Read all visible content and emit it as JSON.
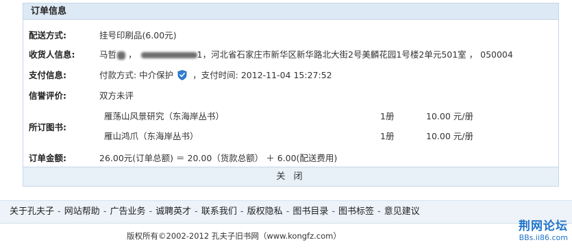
{
  "order": {
    "title": "订单信息",
    "shipping": {
      "label": "配送方式:",
      "value": "挂号印刷品(6.00元)"
    },
    "recipient": {
      "label": "收货人信息:",
      "name_prefix": "马哲",
      "separator1": "，",
      "phone_suffix": "1",
      "address": "，河北省石家庄市新华区新华路北大街2号美麟花园1号楼2单元501室 ， 050004"
    },
    "payment": {
      "label": "支付信息:",
      "method_prefix": "付款方式: 中介保护",
      "time_text": "，支付时间: 2012-11-04 15:27:52"
    },
    "rating": {
      "label": "信誉评价:",
      "value": "双方未评"
    },
    "books": {
      "label": "所订图书:",
      "items": [
        {
          "name": "雁荡山风景研究（东海岸丛书）",
          "qty": "1册",
          "price": "10.00 元/册"
        },
        {
          "name": "雁山鸿爪（东海岸丛书）",
          "qty": "1册",
          "price": "10.00 元/册"
        }
      ]
    },
    "total": {
      "label": "订单金额:",
      "value": "26.00元(订单总额) ＝ 20.00（货款总额） ＋ 6.00(配送费用)"
    },
    "close_label": "关 闭"
  },
  "footer": {
    "links": [
      "关于孔夫子",
      "网站帮助",
      "广告业务",
      "诚聘英才",
      "联系我们",
      "版权隐私",
      "图书目录",
      "图书标签",
      "意见建议"
    ],
    "separator": "-",
    "copyright": "版权所有©2002-2012 孔夫子旧书网（www.kongfz.com）"
  },
  "watermark": {
    "name": "荆网论坛",
    "url": "BBs.ii86.com"
  },
  "colors": {
    "header_bg": "#dde9f5",
    "border": "#c5d6e6",
    "nav_bg": "#eef3f9",
    "watermark": "#1e73c8"
  },
  "icons": {
    "payment_shield": "shield-icon"
  }
}
